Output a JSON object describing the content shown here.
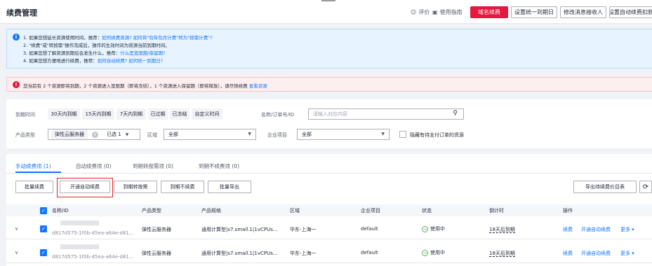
{
  "header": {
    "title": "续费管理",
    "rate_label": "评价",
    "guide_label": "使用指南",
    "buttons": [
      "域名续费",
      "设置统一到期日",
      "修改消息接收人",
      "设置自动续费扣款日"
    ]
  },
  "tips": {
    "lines": [
      {
        "prefix": "1. 如果您想延长资源使用时间，推荐：",
        "links": "如何续费资源?  如何将\"包年包月计费\"转为\"按需计费\"?"
      },
      {
        "prefix": "2. \"续费\"或\"转按需\"操作完成后，操作的生效时间为资源当前到期时间。",
        "links": ""
      },
      {
        "prefix": "3. 如果您想了解资源到期后会发生什么，推荐：",
        "links": "什么是宽限期/保留期?"
      },
      {
        "prefix": "4. 如果您想方便地进行续费，推荐：",
        "links": "如何自动续费?  如何统一到期日?"
      }
    ]
  },
  "warning": {
    "text": "您当前有 2 个资源即将到期，2 个资源进入宽限期（即将冻结），1 个资源进入保留期（即将释放），请尽快续费",
    "link": "查看资源"
  },
  "filters": {
    "expire_label": "到期时间",
    "expire_chips": [
      "30天内到期",
      "15天内到期",
      "7天内到期",
      "已过期",
      "已冻结",
      "自定义时间"
    ],
    "name_label": "名称/订单号/ID",
    "name_placeholder": "请输入对应内容",
    "product_type_label": "产品类型",
    "product_type_tag": "弹性云服务器",
    "product_type_selected": "已选 1",
    "region_label": "区域",
    "region_value": "全部",
    "project_label": "企业项目",
    "project_value": "全部",
    "hide_unpaid_label": "隐藏有待支付订单的资源"
  },
  "tabs": [
    "手动续费项 (1)",
    "自动续费项 (0)",
    "到期转按需项 (0)",
    "到期不续费项 (0)"
  ],
  "toolbar": {
    "buttons": [
      "批量续费",
      "开通自动续费",
      "到期转按需",
      "到期不续费",
      "批量导出"
    ],
    "export_price": "导出待续费价目表"
  },
  "table": {
    "columns": [
      "名称/ID",
      "产品类型",
      "产品规格",
      "区域",
      "企业项目",
      "状态",
      "倒计时",
      "操作"
    ],
    "rows": [
      {
        "id": "d817d575-1f0b-45ea-a64e-d61...",
        "type": "弹性云服务器",
        "spec": "通用计算型|s7.small.1|1vCPUs...",
        "region": "华东-上海一",
        "project": "default",
        "status": "使用中",
        "countdown": "18天后到期",
        "actions": [
          "续费",
          "开通自动续费",
          "更多"
        ]
      },
      {
        "id": "d817d575-1f0b-45ea-a64e-d61...",
        "type": "弹性云服务器",
        "spec": "通用计算型|s7.small.1|1vCPUs...",
        "region": "华东-上海一",
        "project": "default",
        "status": "使用中",
        "countdown": "18天后到期",
        "actions": [
          "续费",
          "开通自动续费",
          "更多"
        ]
      }
    ]
  },
  "colors": {
    "accent": "#1476ff",
    "brand": "#e4173f",
    "ok": "#50b360"
  }
}
